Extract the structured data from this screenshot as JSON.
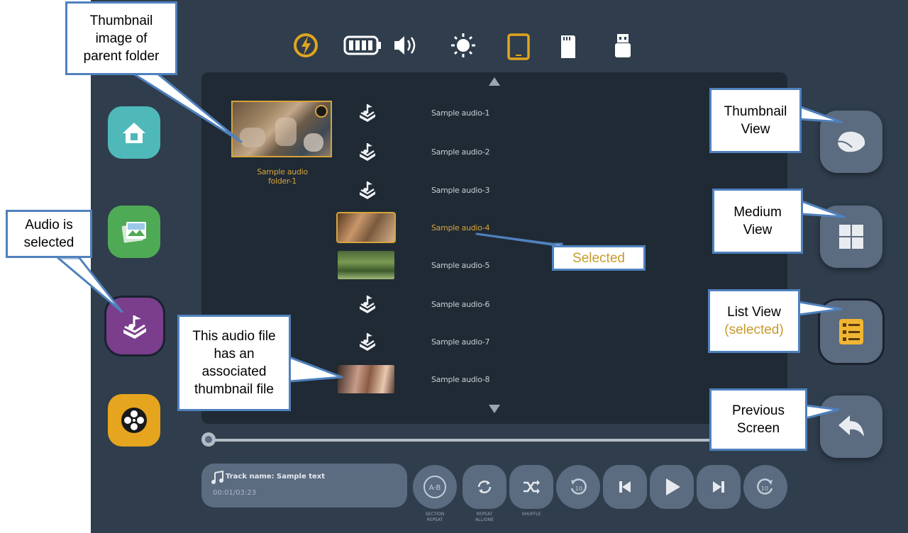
{
  "status_bar": {
    "icons": [
      "power-icon",
      "battery-icon",
      "volume-icon",
      "brightness-icon",
      "tablet-icon",
      "sd-card-icon",
      "usb-icon"
    ]
  },
  "folder": {
    "label_line1": "Sample audio",
    "label_line2": "folder-1"
  },
  "files": [
    {
      "label": "Sample audio-1",
      "type": "audio-icon",
      "thumbnail": false,
      "selected": false
    },
    {
      "label": "Sample audio-2",
      "type": "audio-icon",
      "thumbnail": false,
      "selected": false
    },
    {
      "label": "Sample audio-3",
      "type": "audio-icon",
      "thumbnail": false,
      "selected": false
    },
    {
      "label": "Sample audio-4",
      "type": "thumbnail",
      "thumbnail": true,
      "selected": true
    },
    {
      "label": "Sample audio-5",
      "type": "thumbnail",
      "thumbnail": true,
      "selected": false
    },
    {
      "label": "Sample audio-6",
      "type": "audio-icon",
      "thumbnail": false,
      "selected": false
    },
    {
      "label": "Sample audio-7",
      "type": "audio-icon",
      "thumbnail": false,
      "selected": false
    },
    {
      "label": "Sample audio-8",
      "type": "thumbnail",
      "thumbnail": true,
      "selected": false
    }
  ],
  "left_sidebar": [
    "home-icon",
    "photo-icon",
    "audio-icon",
    "video-icon"
  ],
  "right_sidebar": [
    "thumbnail-view-icon",
    "medium-view-icon",
    "list-view-icon",
    "back-icon"
  ],
  "player": {
    "track_name": "Track name: Sample text",
    "time": "00:01/03:23",
    "controls": [
      {
        "icon": "ab-repeat-icon",
        "label1": "SECTION",
        "label2": "REPEAT"
      },
      {
        "icon": "repeat-icon",
        "label1": "REPEAT",
        "label2": "ALL/ONE"
      },
      {
        "icon": "shuffle-icon",
        "label1": "SHUFFLE",
        "label2": ""
      },
      {
        "icon": "rewind-icon",
        "label1": "",
        "label2": ""
      },
      {
        "icon": "previous-icon",
        "label1": "",
        "label2": ""
      },
      {
        "icon": "play-icon",
        "label1": "",
        "label2": ""
      },
      {
        "icon": "next-icon",
        "label1": "",
        "label2": ""
      },
      {
        "icon": "forward-icon",
        "label1": "",
        "label2": ""
      }
    ]
  },
  "callouts": {
    "parent_folder_1": "Thumbnail",
    "parent_folder_2": "image of",
    "parent_folder_3": "parent folder",
    "audio_selected_1": "Audio is",
    "audio_selected_2": "selected",
    "assoc_1": "This audio file",
    "assoc_2": "has an",
    "assoc_3": "associated",
    "assoc_4": "thumbnail file",
    "selected": "Selected",
    "thumbnail_view_1": "Thumbnail",
    "thumbnail_view_2": "View",
    "medium_view_1": "Medium",
    "medium_view_2": "View",
    "list_view_1": "List View",
    "list_view_2": "(selected)",
    "previous_1": "Previous",
    "previous_2": "Screen"
  },
  "colors": {
    "background": "#2f3d4c",
    "panel": "#1f2a35",
    "accent": "#d7a43a",
    "callout_border": "#4f81bd"
  }
}
